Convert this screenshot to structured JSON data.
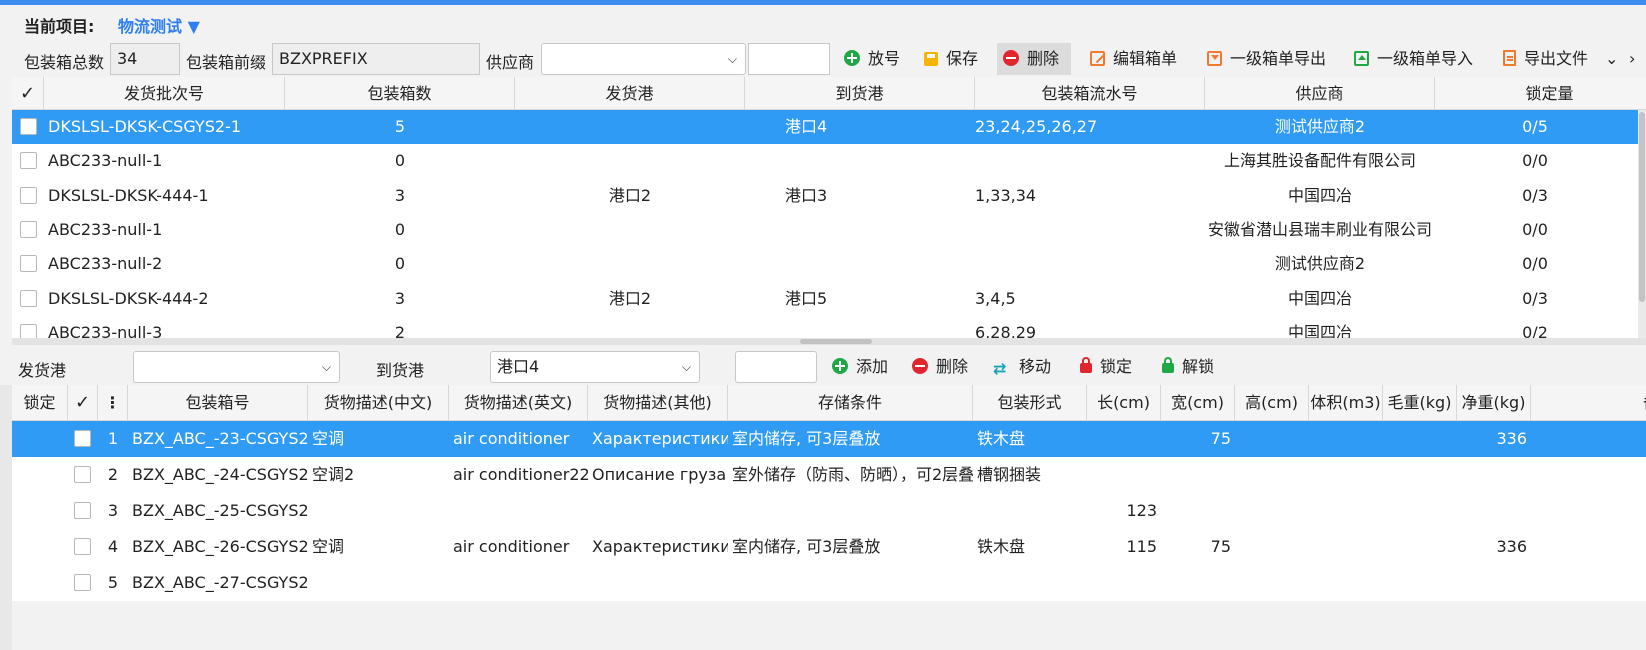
{
  "project": {
    "label": "当前项目:",
    "value": "物流测试 ▼"
  },
  "toolbar1": {
    "total_label": "包装箱总数",
    "total_value": "34",
    "prefix_label": "包装箱前缀",
    "prefix_value": "BZXPREFIX",
    "supplier_label": "供应商",
    "supplier_value": "",
    "search_value": "",
    "buttons": {
      "issue": "放号",
      "save": "保存",
      "delete": "删除",
      "edit_box": "编辑箱单",
      "export_level1": "一级箱单导出",
      "import_level1": "一级箱单导入",
      "export_file": "导出文件"
    },
    "more_chevron": "⌄",
    "more_arrow": "›"
  },
  "batch_table": {
    "check_header": "✓",
    "columns": [
      "发货批次号",
      "包装箱数",
      "发货港",
      "到货港",
      "包装箱流水号",
      "供应商",
      "锁定量"
    ],
    "rows": [
      {
        "batch": "DKSLSL-DKSK-CSGYS2-1",
        "count": "5",
        "from_port": "",
        "to_port": "港口4",
        "serials": "23,24,25,26,27",
        "supplier": "测试供应商2",
        "locked": "0/5",
        "selected": true
      },
      {
        "batch": "ABC233-null-1",
        "count": "0",
        "from_port": "",
        "to_port": "",
        "serials": "",
        "supplier": "上海其胜设备配件有限公司",
        "locked": "0/0"
      },
      {
        "batch": "DKSLSL-DKSK-444-1",
        "count": "3",
        "from_port": "港口2",
        "to_port": "港口3",
        "serials": "1,33,34",
        "supplier": "中国四冶",
        "locked": "0/3"
      },
      {
        "batch": "ABC233-null-1",
        "count": "0",
        "from_port": "",
        "to_port": "",
        "serials": "",
        "supplier": "安徽省潜山县瑞丰刷业有限公司",
        "locked": "0/0"
      },
      {
        "batch": "ABC233-null-2",
        "count": "0",
        "from_port": "",
        "to_port": "",
        "serials": "",
        "supplier": "测试供应商2",
        "locked": "0/0"
      },
      {
        "batch": "DKSLSL-DKSK-444-2",
        "count": "3",
        "from_port": "港口2",
        "to_port": "港口5",
        "serials": "3,4,5",
        "supplier": "中国四冶",
        "locked": "0/3"
      },
      {
        "batch": "ABC233-null-3",
        "count": "2",
        "from_port": "",
        "to_port": "",
        "serials": "6,28,29",
        "supplier": "中国四冶",
        "locked": "0/2"
      }
    ]
  },
  "toolbar2": {
    "from_port_label": "发货港",
    "from_port_value": "",
    "to_port_label": "到货港",
    "to_port_value": "港口4",
    "search_value": "",
    "buttons": {
      "add": "添加",
      "delete": "删除",
      "move": "移动",
      "lock": "锁定",
      "unlock": "解锁"
    }
  },
  "box_table": {
    "lock_header": "锁定",
    "check_header": "✓",
    "menu_header": "⋮",
    "columns": [
      "包装箱号",
      "货物描述(中文)",
      "货物描述(英文)",
      "货物描述(其他)",
      "存储条件",
      "包装形式",
      "长(cm)",
      "宽(cm)",
      "高(cm)",
      "体积(m3)",
      "毛重(kg)",
      "净重(kg)",
      "备"
    ],
    "rows": [
      {
        "no": "1",
        "box": "BZX_ABC_-23-CSGYS2",
        "desc_cn": "空调",
        "desc_en": "air conditioner",
        "desc_other": "Характеристики",
        "storage": "室内储存, 可3层叠放",
        "pack": "铁木盘",
        "length": "",
        "width": "75",
        "height": "",
        "volume": "",
        "gross": "",
        "net": "336",
        "selected": true
      },
      {
        "no": "2",
        "box": "BZX_ABC_-24-CSGYS2",
        "desc_cn": "空调2",
        "desc_en": "air conditioner22",
        "desc_other": "Описание груза",
        "storage": "室外储存（防雨、防晒），可2层叠放",
        "pack": "槽钢捆装",
        "length": "",
        "width": "",
        "height": "",
        "volume": "",
        "gross": "",
        "net": ""
      },
      {
        "no": "3",
        "box": "BZX_ABC_-25-CSGYS2",
        "desc_cn": "",
        "desc_en": "",
        "desc_other": "",
        "storage": "",
        "pack": "",
        "length": "123",
        "width": "",
        "height": "",
        "volume": "",
        "gross": "",
        "net": ""
      },
      {
        "no": "4",
        "box": "BZX_ABC_-26-CSGYS2",
        "desc_cn": "空调",
        "desc_en": "air conditioner",
        "desc_other": "Характеристики",
        "storage": "室内储存, 可3层叠放",
        "pack": "铁木盘",
        "length": "115",
        "width": "75",
        "height": "",
        "volume": "",
        "gross": "",
        "net": "336"
      },
      {
        "no": "5",
        "box": "BZX_ABC_-27-CSGYS2",
        "desc_cn": "",
        "desc_en": "",
        "desc_other": "",
        "storage": "",
        "pack": "",
        "length": "",
        "width": "",
        "height": "",
        "volume": "",
        "gross": "",
        "net": ""
      }
    ]
  },
  "colors": {
    "accent": "#2f9bf5",
    "topbar": "#3d8ef0",
    "link": "#2f7ff0"
  }
}
